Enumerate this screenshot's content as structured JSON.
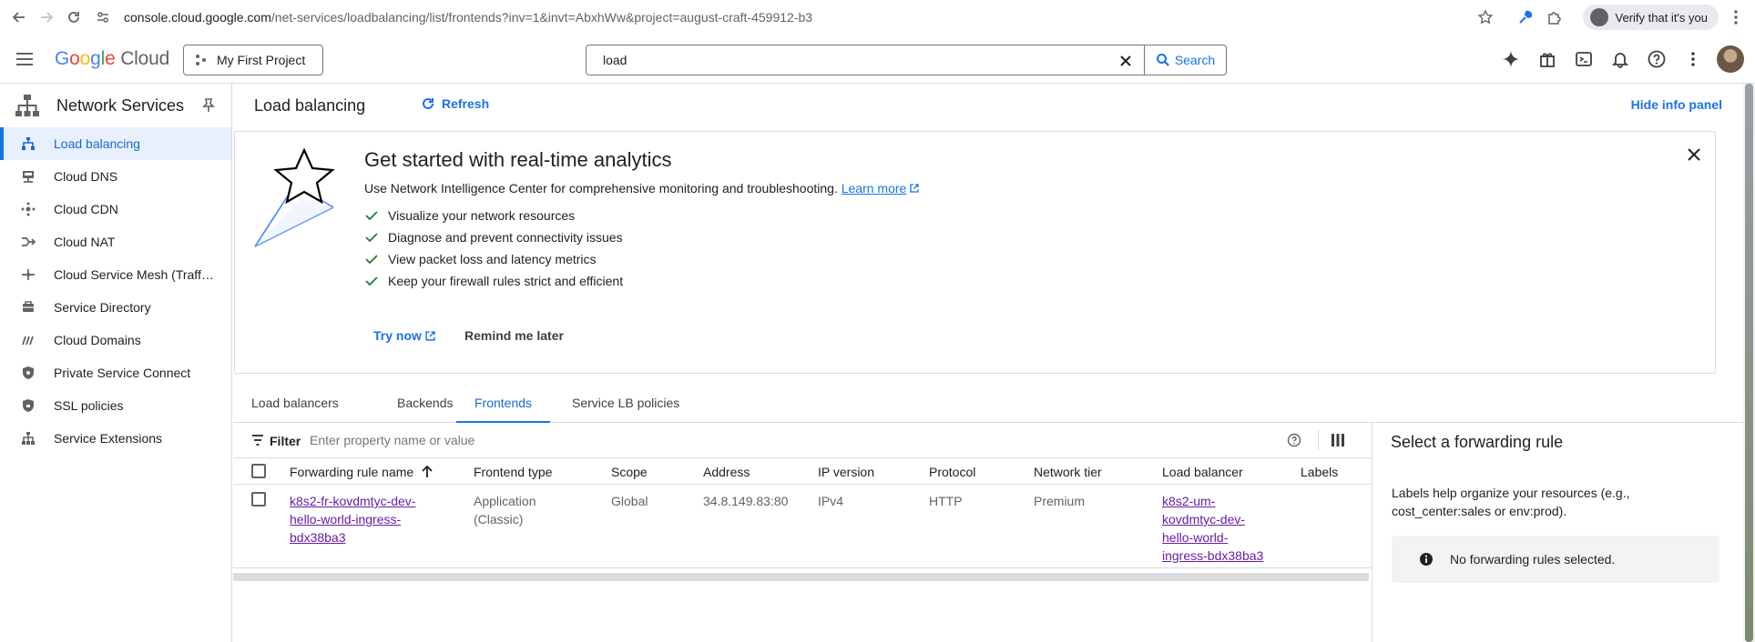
{
  "browser": {
    "url_host": "console.cloud.google.com",
    "url_path": "/net-services/loadbalancing/list/frontends?inv=1&invt=AbxhWw&project=august-craft-459912-b3",
    "verify_label": "Verify that it's you"
  },
  "header": {
    "logo_google": "Google",
    "logo_cloud": "Cloud",
    "project_label": "My First Project",
    "search_value": "load",
    "search_button_label": "Search"
  },
  "sidebar": {
    "title": "Network Services",
    "items": [
      {
        "label": "Load balancing",
        "icon": "load-balancing-icon",
        "active": true
      },
      {
        "label": "Cloud DNS",
        "icon": "dns-icon"
      },
      {
        "label": "Cloud CDN",
        "icon": "cdn-icon"
      },
      {
        "label": "Cloud NAT",
        "icon": "nat-icon"
      },
      {
        "label": "Cloud Service Mesh (Traff…",
        "icon": "service-mesh-icon"
      },
      {
        "label": "Service Directory",
        "icon": "directory-icon"
      },
      {
        "label": "Cloud Domains",
        "icon": "domains-icon"
      },
      {
        "label": "Private Service Connect",
        "icon": "private-connect-icon"
      },
      {
        "label": "SSL policies",
        "icon": "shield-icon"
      },
      {
        "label": "Service Extensions",
        "icon": "extensions-icon"
      }
    ]
  },
  "page": {
    "title": "Load balancing",
    "refresh_label": "Refresh",
    "hide_info_label": "Hide info panel"
  },
  "promo": {
    "title": "Get started with real-time analytics",
    "description": "Use Network Intelligence Center for comprehensive monitoring and troubleshooting.",
    "learn_more": "Learn more",
    "checklist": [
      "Visualize your network resources",
      "Diagnose and prevent connectivity issues",
      "View packet loss and latency metrics",
      "Keep your firewall rules strict and efficient"
    ],
    "try_now": "Try now",
    "remind_later": "Remind me later"
  },
  "tabs": [
    {
      "label": "Load balancers"
    },
    {
      "label": "Backends"
    },
    {
      "label": "Frontends",
      "active": true
    },
    {
      "label": "Service LB policies"
    }
  ],
  "filter": {
    "label": "Filter",
    "placeholder": "Enter property name or value"
  },
  "table": {
    "columns": [
      "Forwarding rule name",
      "Frontend type",
      "Scope",
      "Address",
      "IP version",
      "Protocol",
      "Network tier",
      "Load balancer",
      "Labels"
    ],
    "rows": [
      {
        "name_lines": [
          "k8s2-fr-kovdmtyc-dev-",
          "hello-world-ingress-",
          "bdx38ba3"
        ],
        "frontend_type_lines": [
          "Application",
          "(Classic)"
        ],
        "scope": "Global",
        "address": "34.8.149.83:80",
        "ip_version": "IPv4",
        "protocol": "HTTP",
        "network_tier": "Premium",
        "load_balancer_lines": [
          "k8s2-um-",
          "kovdmtyc-dev-",
          "hello-world-",
          "ingress-bdx38ba3"
        ],
        "labels": ""
      }
    ]
  },
  "info_panel": {
    "title": "Select a forwarding rule",
    "description": "Labels help organize your resources (e.g., cost_center:sales or env:prod).",
    "empty_message": "No forwarding rules selected."
  }
}
